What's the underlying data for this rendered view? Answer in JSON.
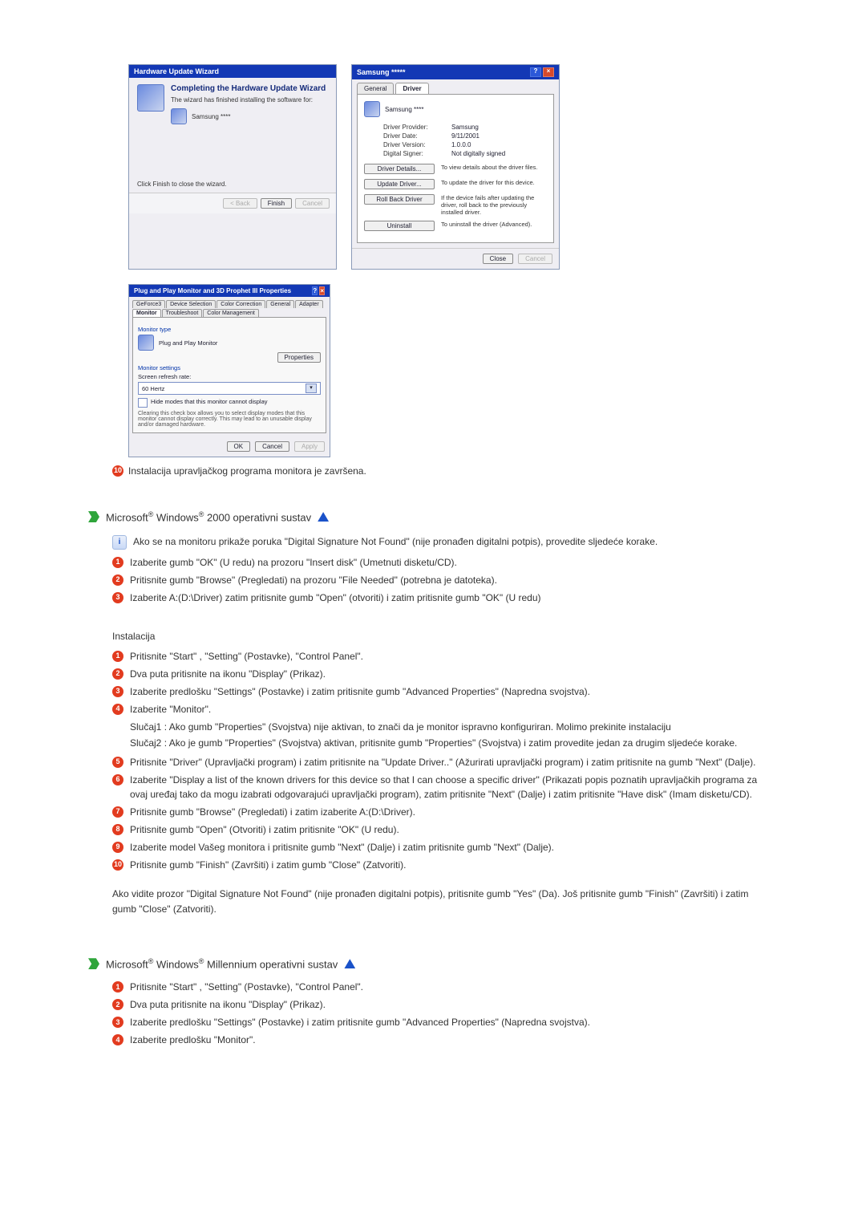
{
  "hw_wizard": {
    "title": "Hardware Update Wizard",
    "head": "Completing the Hardware Update Wizard",
    "sub": "The wizard has finished installing the software for:",
    "device": "Samsung ****",
    "finish_hint": "Click Finish to close the wizard.",
    "btn_back": "< Back",
    "btn_finish": "Finish",
    "btn_cancel": "Cancel"
  },
  "drv_props": {
    "title": "Samsung *****",
    "tab_general": "General",
    "tab_driver": "Driver",
    "device": "Samsung ****",
    "provider_k": "Driver Provider:",
    "provider_v": "Samsung",
    "date_k": "Driver Date:",
    "date_v": "9/11/2001",
    "version_k": "Driver Version:",
    "version_v": "1.0.0.0",
    "signer_k": "Digital Signer:",
    "signer_v": "Not digitally signed",
    "btn_details": "Driver Details...",
    "btn_details_desc": "To view details about the driver files.",
    "btn_update": "Update Driver...",
    "btn_update_desc": "To update the driver for this device.",
    "btn_rollback": "Roll Back Driver",
    "btn_rollback_desc": "If the device fails after updating the driver, roll back to the previously installed driver.",
    "btn_uninstall": "Uninstall",
    "btn_uninstall_desc": "To uninstall the driver (Advanced).",
    "btn_close": "Close",
    "btn_cancel": "Cancel"
  },
  "monitor_props": {
    "title": "Plug and Play Monitor and 3D Prophet III Properties",
    "tabs": {
      "a": "GeForce3",
      "b": "Device Selection",
      "c": "Color Correction",
      "d": "General",
      "e": "Adapter",
      "f": "Monitor",
      "g": "Troubleshoot",
      "h": "Color Management"
    },
    "grp_type": "Monitor type",
    "type_val": "Plug and Play Monitor",
    "btn_props": "Properties",
    "grp_settings": "Monitor settings",
    "refresh_lbl": "Screen refresh rate:",
    "refresh_val": "60 Hertz",
    "chk": "Hide modes that this monitor cannot display",
    "chk_note": "Clearing this check box allows you to select display modes that this monitor cannot display correctly. This may lead to an unusable display and/or damaged hardware.",
    "btn_ok": "OK",
    "btn_cancel": "Cancel",
    "btn_apply": "Apply"
  },
  "done_step": {
    "num": "10",
    "text": "Instalacija upravljačkog programa monitora je završena."
  },
  "win2000": {
    "brand_a": "Microsoft",
    "brand_b": "Windows",
    "tail": "2000 operativni sustav",
    "intro": "Ako se na monitoru prikaže poruka \"Digital Signature Not Found\" (nije pronađen digitalni potpis), provedite sljedeće korake.",
    "s1": "Izaberite gumb \"OK\" (U redu) na prozoru \"Insert disk\" (Umetnuti disketu/CD).",
    "s2": "Pritisnite gumb \"Browse\" (Pregledati) na prozoru \"File Needed\" (potrebna je datoteka).",
    "s3": "Izaberite A:(D:\\Driver) zatim pritisnite gumb \"Open\" (otvoriti) i zatim pritisnite gumb \"OK\" (U redu)",
    "install_hdr": "Instalacija",
    "i1": "Pritisnite \"Start\" , \"Setting\" (Postavke), \"Control Panel\".",
    "i2": "Dva puta pritisnite na ikonu \"Display\" (Prikaz).",
    "i3": "Izaberite predlošku \"Settings\" (Postavke) i zatim pritisnite gumb \"Advanced Properties\" (Napredna svojstva).",
    "i4": "Izaberite \"Monitor\".",
    "i4c1": "Slučaj1 : Ako gumb \"Properties\" (Svojstva) nije aktivan, to znači da je monitor ispravno konfiguriran. Molimo prekinite instalaciju",
    "i4c2": "Slučaj2 : Ako je gumb \"Properties\" (Svojstva) aktivan, pritisnite gumb \"Properties\" (Svojstva) i zatim provedite jedan za drugim sljedeće korake.",
    "i5": "Pritisnite \"Driver\" (Upravljački program) i zatim pritisnite na \"Update Driver..\" (Ažurirati upravljački program) i zatim pritisnite na gumb \"Next\" (Dalje).",
    "i6": "Izaberite \"Display a list of the known drivers for this device so that I can choose a specific driver\" (Prikazati popis poznatih upravljačkih programa za ovaj uređaj tako da mogu izabrati odgovarajući upravljački program), zatim pritisnite \"Next\" (Dalje) i zatim pritisnite \"Have disk\" (Imam disketu/CD).",
    "i7": "Pritisnite gumb \"Browse\" (Pregledati) i zatim izaberite A:(D:\\Driver).",
    "i8": "Pritisnite gumb \"Open\" (Otvoriti) i zatim pritisnite \"OK\" (U redu).",
    "i9": "Izaberite model Vašeg monitora i pritisnite gumb \"Next\" (Dalje) i zatim pritisnite gumb \"Next\" (Dalje).",
    "i10": "Pritisnite gumb \"Finish\" (Završiti) i zatim gumb \"Close\" (Zatvoriti).",
    "after": "Ako vidite prozor \"Digital Signature Not Found\" (nije pronađen digitalni potpis), pritisnite gumb \"Yes\" (Da). Još pritisnite gumb \"Finish\" (Završiti) i zatim gumb \"Close\" (Zatvoriti)."
  },
  "winme": {
    "brand_a": "Microsoft",
    "brand_b": "Windows",
    "tail": "Millennium operativni sustav",
    "s1": "Pritisnite \"Start\" , \"Setting\" (Postavke), \"Control Panel\".",
    "s2": "Dva puta pritisnite na ikonu \"Display\" (Prikaz).",
    "s3": "Izaberite predlošku \"Settings\" (Postavke) i zatim pritisnite gumb \"Advanced Properties\" (Napredna svojstva).",
    "s4": "Izaberite predlošku \"Monitor\"."
  },
  "nums": {
    "n1": "1",
    "n2": "2",
    "n3": "3",
    "n4": "4",
    "n5": "5",
    "n6": "6",
    "n7": "7",
    "n8": "8",
    "n9": "9",
    "n10": "10"
  }
}
